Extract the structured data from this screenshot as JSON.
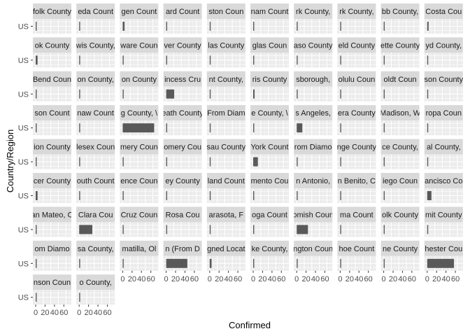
{
  "chart_data": {
    "type": "bar",
    "orientation": "horizontal",
    "layout": "facet_wrap",
    "xlabel": "Confirmed",
    "ylabel": "Country/Region",
    "x_ticks": [
      "0",
      "20",
      "40",
      "60"
    ],
    "xlim": [
      0,
      70
    ],
    "category": "US",
    "bar_color": "#595959",
    "panel_color": "#ebebeb",
    "strip_color": "#d9d9d9",
    "grid": true,
    "panels": [
      {
        "label": "folk County",
        "value": 1
      },
      {
        "label": "eda Count",
        "value": 1
      },
      {
        "label": "gen Count",
        "value": 4
      },
      {
        "label": "ard Count",
        "value": 1
      },
      {
        "label": "ston Coun",
        "value": 1
      },
      {
        "label": "nam Count",
        "value": 1
      },
      {
        "label": "rk County,",
        "value": 1
      },
      {
        "label": "rk County,",
        "value": 1
      },
      {
        "label": "bb County,",
        "value": 1
      },
      {
        "label": "Costa Cou",
        "value": 3
      },
      {
        "label": "ok County",
        "value": 4
      },
      {
        "label": "wis County,",
        "value": 1
      },
      {
        "label": "ware Coun",
        "value": 1
      },
      {
        "label": "ver County",
        "value": 1
      },
      {
        "label": "las County",
        "value": 1
      },
      {
        "label": "glas Coun",
        "value": 1
      },
      {
        "label": "aso County",
        "value": 1
      },
      {
        "label": "eld County",
        "value": 1
      },
      {
        "label": "ette County",
        "value": 1
      },
      {
        "label": "yd County,",
        "value": 1
      },
      {
        "label": "Bend Coun",
        "value": 1
      },
      {
        "label": "on County,",
        "value": 2
      },
      {
        "label": "on County",
        "value": 1
      },
      {
        "label": "incess Cru",
        "value": 17
      },
      {
        "label": "nt County,",
        "value": 1
      },
      {
        "label": "ris County",
        "value": 3
      },
      {
        "label": "sborough,",
        "value": 1
      },
      {
        "label": "olulu Coun",
        "value": 1
      },
      {
        "label": "oldt Coun",
        "value": 1
      },
      {
        "label": "son County",
        "value": 1
      },
      {
        "label": "son Count",
        "value": 1
      },
      {
        "label": "naw Count",
        "value": 1
      },
      {
        "label": "g County, \\",
        "value": 67
      },
      {
        "label": "eath County",
        "value": 1
      },
      {
        "label": "From Diam",
        "value": 1
      },
      {
        "label": "e County, \\",
        "value": 1
      },
      {
        "label": "s Angeles,",
        "value": 12
      },
      {
        "label": "era County",
        "value": 1
      },
      {
        "label": "Madison, W",
        "value": 1
      },
      {
        "label": "ropa Coun",
        "value": 1
      },
      {
        "label": "ion County",
        "value": 1
      },
      {
        "label": "lesex Coun",
        "value": 1
      },
      {
        "label": "mery Coun",
        "value": 1
      },
      {
        "label": "omery Cou",
        "value": 1
      },
      {
        "label": "sau County",
        "value": 1
      },
      {
        "label": "York Count",
        "value": 10
      },
      {
        "label": "rom Diamo",
        "value": 1
      },
      {
        "label": "nge County",
        "value": 1
      },
      {
        "label": "ce County,",
        "value": 1
      },
      {
        "label": "al County,",
        "value": 1
      },
      {
        "label": "cer County",
        "value": 4
      },
      {
        "label": "outh Count",
        "value": 1
      },
      {
        "label": "ence Coun",
        "value": 1
      },
      {
        "label": "ey County",
        "value": 1
      },
      {
        "label": "land Count",
        "value": 1
      },
      {
        "label": "mento Cou",
        "value": 1
      },
      {
        "label": "n Antonio,",
        "value": 1
      },
      {
        "label": "n Benito, C",
        "value": 1
      },
      {
        "label": "iego Coun",
        "value": 1
      },
      {
        "label": "ancisco Co",
        "value": 9
      },
      {
        "label": "an Mateo, C",
        "value": 1
      },
      {
        "label": "Clara Cou",
        "value": 28
      },
      {
        "label": "Cruz Coun",
        "value": 1
      },
      {
        "label": "Rosa Cou",
        "value": 1
      },
      {
        "label": "arasota, F",
        "value": 1
      },
      {
        "label": "oga Count",
        "value": 1
      },
      {
        "label": "omish Coun",
        "value": 24
      },
      {
        "label": "ma Count",
        "value": 1
      },
      {
        "label": "olk County",
        "value": 1
      },
      {
        "label": "mit County",
        "value": 1
      },
      {
        "label": "om Diamo",
        "value": 1
      },
      {
        "label": "sa County,",
        "value": 1
      },
      {
        "label": "matilla, Ol",
        "value": 1
      },
      {
        "label": "n (From D",
        "value": 45
      },
      {
        "label": "gned Locat",
        "value": 4
      },
      {
        "label": "ke County,",
        "value": 1
      },
      {
        "label": "ngton Coun",
        "value": 1
      },
      {
        "label": "hoe Count",
        "value": 1
      },
      {
        "label": "ne County",
        "value": 1
      },
      {
        "label": "hester Cou",
        "value": 57
      },
      {
        "label": "nson Coun",
        "value": 1
      },
      {
        "label": "o County,",
        "value": 1
      }
    ]
  }
}
